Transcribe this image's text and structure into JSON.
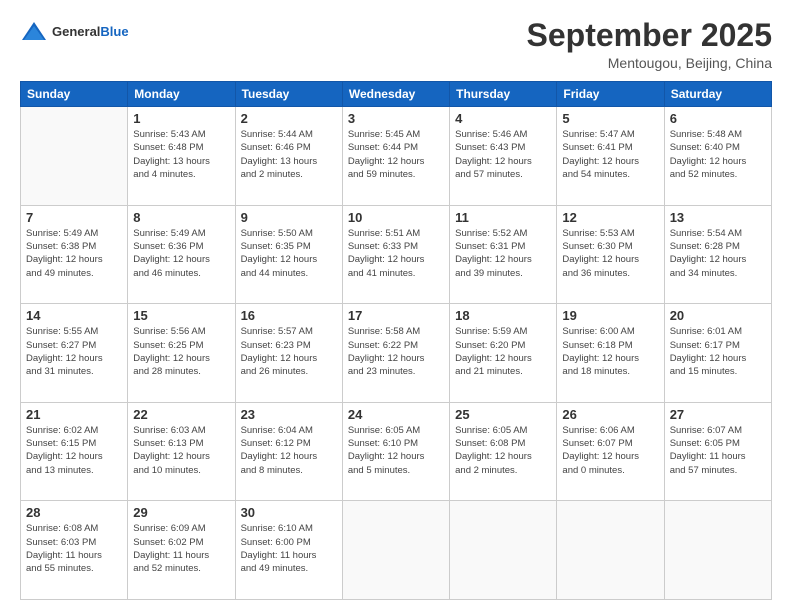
{
  "header": {
    "logo_general": "General",
    "logo_blue": "Blue",
    "month_title": "September 2025",
    "location": "Mentougou, Beijing, China"
  },
  "days_of_week": [
    "Sunday",
    "Monday",
    "Tuesday",
    "Wednesday",
    "Thursday",
    "Friday",
    "Saturday"
  ],
  "weeks": [
    [
      {
        "day": "",
        "info": ""
      },
      {
        "day": "1",
        "info": "Sunrise: 5:43 AM\nSunset: 6:48 PM\nDaylight: 13 hours\nand 4 minutes."
      },
      {
        "day": "2",
        "info": "Sunrise: 5:44 AM\nSunset: 6:46 PM\nDaylight: 13 hours\nand 2 minutes."
      },
      {
        "day": "3",
        "info": "Sunrise: 5:45 AM\nSunset: 6:44 PM\nDaylight: 12 hours\nand 59 minutes."
      },
      {
        "day": "4",
        "info": "Sunrise: 5:46 AM\nSunset: 6:43 PM\nDaylight: 12 hours\nand 57 minutes."
      },
      {
        "day": "5",
        "info": "Sunrise: 5:47 AM\nSunset: 6:41 PM\nDaylight: 12 hours\nand 54 minutes."
      },
      {
        "day": "6",
        "info": "Sunrise: 5:48 AM\nSunset: 6:40 PM\nDaylight: 12 hours\nand 52 minutes."
      }
    ],
    [
      {
        "day": "7",
        "info": "Sunrise: 5:49 AM\nSunset: 6:38 PM\nDaylight: 12 hours\nand 49 minutes."
      },
      {
        "day": "8",
        "info": "Sunrise: 5:49 AM\nSunset: 6:36 PM\nDaylight: 12 hours\nand 46 minutes."
      },
      {
        "day": "9",
        "info": "Sunrise: 5:50 AM\nSunset: 6:35 PM\nDaylight: 12 hours\nand 44 minutes."
      },
      {
        "day": "10",
        "info": "Sunrise: 5:51 AM\nSunset: 6:33 PM\nDaylight: 12 hours\nand 41 minutes."
      },
      {
        "day": "11",
        "info": "Sunrise: 5:52 AM\nSunset: 6:31 PM\nDaylight: 12 hours\nand 39 minutes."
      },
      {
        "day": "12",
        "info": "Sunrise: 5:53 AM\nSunset: 6:30 PM\nDaylight: 12 hours\nand 36 minutes."
      },
      {
        "day": "13",
        "info": "Sunrise: 5:54 AM\nSunset: 6:28 PM\nDaylight: 12 hours\nand 34 minutes."
      }
    ],
    [
      {
        "day": "14",
        "info": "Sunrise: 5:55 AM\nSunset: 6:27 PM\nDaylight: 12 hours\nand 31 minutes."
      },
      {
        "day": "15",
        "info": "Sunrise: 5:56 AM\nSunset: 6:25 PM\nDaylight: 12 hours\nand 28 minutes."
      },
      {
        "day": "16",
        "info": "Sunrise: 5:57 AM\nSunset: 6:23 PM\nDaylight: 12 hours\nand 26 minutes."
      },
      {
        "day": "17",
        "info": "Sunrise: 5:58 AM\nSunset: 6:22 PM\nDaylight: 12 hours\nand 23 minutes."
      },
      {
        "day": "18",
        "info": "Sunrise: 5:59 AM\nSunset: 6:20 PM\nDaylight: 12 hours\nand 21 minutes."
      },
      {
        "day": "19",
        "info": "Sunrise: 6:00 AM\nSunset: 6:18 PM\nDaylight: 12 hours\nand 18 minutes."
      },
      {
        "day": "20",
        "info": "Sunrise: 6:01 AM\nSunset: 6:17 PM\nDaylight: 12 hours\nand 15 minutes."
      }
    ],
    [
      {
        "day": "21",
        "info": "Sunrise: 6:02 AM\nSunset: 6:15 PM\nDaylight: 12 hours\nand 13 minutes."
      },
      {
        "day": "22",
        "info": "Sunrise: 6:03 AM\nSunset: 6:13 PM\nDaylight: 12 hours\nand 10 minutes."
      },
      {
        "day": "23",
        "info": "Sunrise: 6:04 AM\nSunset: 6:12 PM\nDaylight: 12 hours\nand 8 minutes."
      },
      {
        "day": "24",
        "info": "Sunrise: 6:05 AM\nSunset: 6:10 PM\nDaylight: 12 hours\nand 5 minutes."
      },
      {
        "day": "25",
        "info": "Sunrise: 6:05 AM\nSunset: 6:08 PM\nDaylight: 12 hours\nand 2 minutes."
      },
      {
        "day": "26",
        "info": "Sunrise: 6:06 AM\nSunset: 6:07 PM\nDaylight: 12 hours\nand 0 minutes."
      },
      {
        "day": "27",
        "info": "Sunrise: 6:07 AM\nSunset: 6:05 PM\nDaylight: 11 hours\nand 57 minutes."
      }
    ],
    [
      {
        "day": "28",
        "info": "Sunrise: 6:08 AM\nSunset: 6:03 PM\nDaylight: 11 hours\nand 55 minutes."
      },
      {
        "day": "29",
        "info": "Sunrise: 6:09 AM\nSunset: 6:02 PM\nDaylight: 11 hours\nand 52 minutes."
      },
      {
        "day": "30",
        "info": "Sunrise: 6:10 AM\nSunset: 6:00 PM\nDaylight: 11 hours\nand 49 minutes."
      },
      {
        "day": "",
        "info": ""
      },
      {
        "day": "",
        "info": ""
      },
      {
        "day": "",
        "info": ""
      },
      {
        "day": "",
        "info": ""
      }
    ]
  ]
}
